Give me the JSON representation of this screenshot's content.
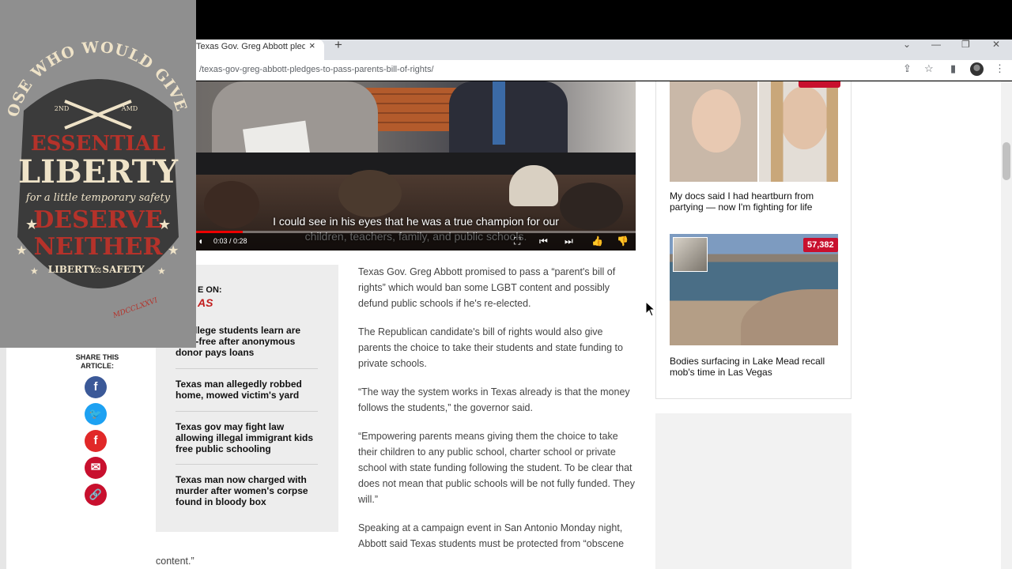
{
  "browser": {
    "tab_title": "Texas Gov. Greg Abbott pledges",
    "tab_close": "×",
    "new_tab": "+",
    "window_controls": [
      "⌄",
      "—",
      "❐",
      "✕"
    ],
    "url": "/texas-gov-greg-abbott-pledges-to-pass-parents-bill-of-rights/",
    "toolbar_icons": [
      "share-icon",
      "star-icon",
      "sidepanel-icon",
      "profile-icon",
      "menu-icon"
    ]
  },
  "video": {
    "caption_line1": "I could see in his eyes that he was a true champion for our",
    "caption_line2": "children, teachers, family, and public schools.",
    "time": "0:03 / 0:28",
    "progress": 0.107
  },
  "share": {
    "label": "SHARE THIS ARTICLE:",
    "icons": [
      {
        "name": "facebook-icon",
        "glyph": "f",
        "color": "#3b5998"
      },
      {
        "name": "twitter-icon",
        "glyph": "🐦",
        "color": "#1da1f2"
      },
      {
        "name": "flipboard-icon",
        "glyph": "f",
        "color": "#e12828"
      },
      {
        "name": "email-icon",
        "glyph": "✉",
        "color": "#c8102e"
      },
      {
        "name": "link-icon",
        "glyph": "🔗",
        "color": "#c8102e"
      }
    ]
  },
  "more": {
    "heading": "E ON:",
    "topic": "AS",
    "items": [
      "s college students learn are debt-free after anonymous donor pays loans",
      "Texas man allegedly robbed home, mowed victim's yard",
      "Texas gov may fight law allowing illegal immigrant kids free public schooling",
      "Texas man now charged with murder after women's corpse found in bloody box"
    ]
  },
  "article": {
    "paragraphs": [
      "Texas Gov. Greg Abbott promised to pass a “parent's bill of rights” which would ban some LGBT content and possibly defund public schools if he's re-elected.",
      "The Republican candidate's bill of rights would also give parents the choice to take their students and state funding to private schools.",
      "“The way the system works in Texas already is that the money follows the students,” the governor said.",
      "“Empowering parents means giving them the choice to take their children to any public school, charter school or private school with state funding following the student. To be clear that does not mean that public schools will be not fully funded. They will.”",
      "Speaking at a campaign event in San Antonio Monday night, Abbott said Texas students must be protected from “obscene"
    ],
    "tail": "content.”"
  },
  "sidebar": {
    "items": [
      {
        "title": "My docs said I had heartburn from partying — now I'm fighting for life"
      },
      {
        "title": "Bodies surfacing in Lake Mead recall mob's time in Las Vegas",
        "badge": "57,382"
      }
    ]
  },
  "logo": {
    "arc_text": "THOSE WHO WOULD GIVE UP",
    "amendment_left": "2ND",
    "amendment_right": "AMD",
    "line1": "ESSENTIAL",
    "line2": "LIBERTY",
    "line3": "for a little temporary safety",
    "line4": "DESERVE",
    "line5": "NEITHER",
    "banner_left": "LIBERTY",
    "banner_right": "SAFETY",
    "year": "MDCCLXXVI"
  },
  "colors": {
    "accent_red": "#c8102e",
    "logo_red": "#b5322a",
    "logo_cream": "#efe3c8",
    "logo_dark": "#3b3b3b"
  }
}
